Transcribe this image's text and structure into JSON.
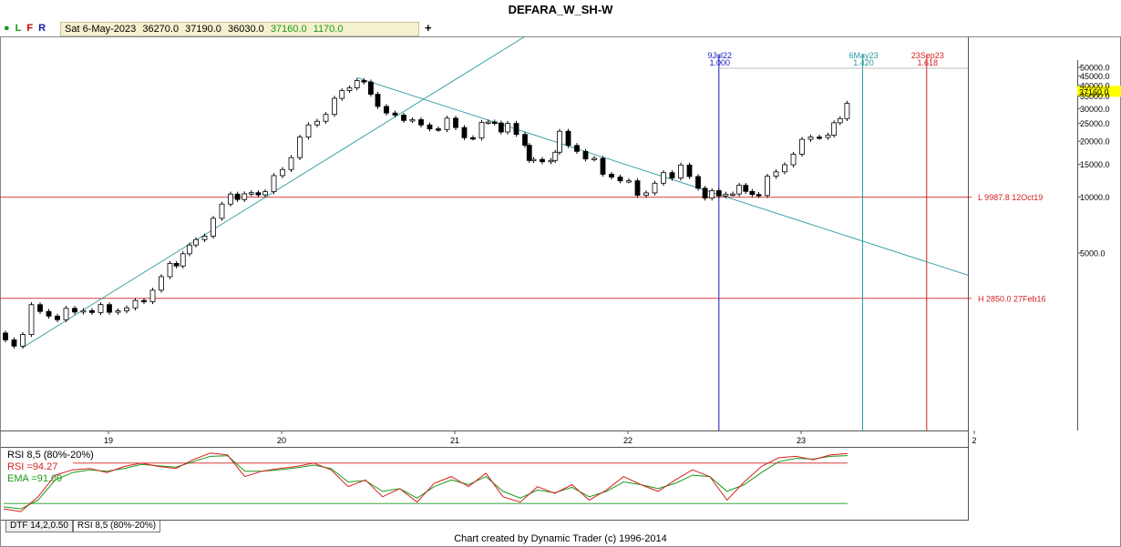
{
  "window": {
    "title": "DEFARA_W_SH-W"
  },
  "toolbar": {
    "icons": [
      {
        "glyph": "●",
        "color": "#1a9a1a",
        "name": "dot-icon"
      },
      {
        "glyph": "L",
        "color": "#1a9a1a",
        "name": "L"
      },
      {
        "glyph": "F",
        "color": "#c00000",
        "name": "F"
      },
      {
        "glyph": "R",
        "color": "#1a1aa0",
        "name": "R"
      }
    ],
    "info": {
      "date": "Sat 6-May-2023",
      "open": "36270.0",
      "high": "37190.0",
      "low": "36030.0",
      "close": "37160.0",
      "change": "1170.0"
    },
    "plus": "+"
  },
  "chart_data": {
    "type": "candlestick",
    "title": "DEFARA_W_SH-W",
    "yscale": "log",
    "y_ticks": [
      "50000.0",
      "45000.0",
      "40000.0",
      "35000.0",
      "30000.0",
      "25000.0",
      "20000.0",
      "15000.0",
      "10000.0",
      "5000.0"
    ],
    "y_tick_values": [
      50000,
      45000,
      40000,
      35000,
      30000,
      25000,
      20000,
      15000,
      10000,
      5000
    ],
    "x_tick_labels": [
      "19",
      "20",
      "21",
      "22",
      "23",
      "2"
    ],
    "last_price_label": "37160.0",
    "horizontal_levels": [
      {
        "label": "L 9987.8 12Oct19",
        "value": 9987.8,
        "color": "#d42020"
      },
      {
        "label": "H 2850.0 27Feb16",
        "value": 2850.0,
        "color": "#d42020"
      }
    ],
    "time_markers": [
      {
        "date": "9Jul22",
        "ratio": "1.000",
        "color": "#1a1ac8"
      },
      {
        "date": "6May23",
        "ratio": "1.420",
        "color": "#2a9aa0"
      },
      {
        "date": "23Sep23",
        "ratio": "1.618",
        "color": "#d42020"
      }
    ],
    "price_series": [
      {
        "t": 2018.35,
        "p": 1800
      },
      {
        "t": 2018.45,
        "p": 1550
      },
      {
        "t": 2018.55,
        "p": 2500
      },
      {
        "t": 2018.65,
        "p": 2300
      },
      {
        "t": 2018.75,
        "p": 2350
      },
      {
        "t": 2018.85,
        "p": 2500
      },
      {
        "t": 2018.95,
        "p": 2450
      },
      {
        "t": 2019.05,
        "p": 2500
      },
      {
        "t": 2019.15,
        "p": 2600
      },
      {
        "t": 2019.25,
        "p": 3200
      },
      {
        "t": 2019.35,
        "p": 4200
      },
      {
        "t": 2019.5,
        "p": 5800
      },
      {
        "t": 2019.6,
        "p": 7500
      },
      {
        "t": 2019.7,
        "p": 10500
      },
      {
        "t": 2019.78,
        "p": 9987.8
      },
      {
        "t": 2019.9,
        "p": 11000
      },
      {
        "t": 2020.0,
        "p": 14000
      },
      {
        "t": 2020.1,
        "p": 21000
      },
      {
        "t": 2020.2,
        "p": 26000
      },
      {
        "t": 2020.3,
        "p": 33000
      },
      {
        "t": 2020.43,
        "p": 44000
      },
      {
        "t": 2020.55,
        "p": 32000
      },
      {
        "t": 2020.65,
        "p": 26000
      },
      {
        "t": 2020.75,
        "p": 27000
      },
      {
        "t": 2020.85,
        "p": 22000
      },
      {
        "t": 2020.95,
        "p": 27000
      },
      {
        "t": 2021.05,
        "p": 20000
      },
      {
        "t": 2021.15,
        "p": 25000
      },
      {
        "t": 2021.3,
        "p": 24000
      },
      {
        "t": 2021.4,
        "p": 19000
      },
      {
        "t": 2021.45,
        "p": 15000
      },
      {
        "t": 2021.55,
        "p": 16000
      },
      {
        "t": 2021.6,
        "p": 21000
      },
      {
        "t": 2021.7,
        "p": 18000
      },
      {
        "t": 2021.8,
        "p": 15000
      },
      {
        "t": 2021.9,
        "p": 13000
      },
      {
        "t": 2022.0,
        "p": 11500
      },
      {
        "t": 2022.1,
        "p": 10500
      },
      {
        "t": 2022.2,
        "p": 13000
      },
      {
        "t": 2022.3,
        "p": 14500
      },
      {
        "t": 2022.4,
        "p": 11000
      },
      {
        "t": 2022.52,
        "p": 10000
      },
      {
        "t": 2022.6,
        "p": 11000
      },
      {
        "t": 2022.75,
        "p": 10500
      },
      {
        "t": 2022.85,
        "p": 14000
      },
      {
        "t": 2022.95,
        "p": 17000
      },
      {
        "t": 2023.05,
        "p": 22000
      },
      {
        "t": 2023.15,
        "p": 21000
      },
      {
        "t": 2023.22,
        "p": 28000
      },
      {
        "t": 2023.3,
        "p": 37160
      }
    ],
    "rsi_panel": {
      "label": "RSI 8,5 (80%-20%)",
      "rsi_label": "RSI =94.27",
      "ema_label": "EMA =91.09",
      "levels": [
        80,
        20
      ],
      "rsi_values": [
        12,
        8,
        30,
        62,
        70,
        72,
        66,
        75,
        80,
        75,
        72,
        85,
        95,
        92,
        60,
        68,
        72,
        75,
        80,
        70,
        45,
        55,
        30,
        42,
        22,
        50,
        60,
        45,
        65,
        30,
        22,
        45,
        35,
        48,
        25,
        40,
        60,
        48,
        38,
        55,
        70,
        60,
        25,
        52,
        75,
        88,
        90,
        85,
        92,
        94.27
      ],
      "ema_values": [
        15,
        12,
        25,
        55,
        66,
        70,
        68,
        72,
        78,
        76,
        74,
        82,
        90,
        91,
        68,
        68,
        70,
        73,
        77,
        72,
        52,
        54,
        38,
        42,
        28,
        45,
        55,
        48,
        60,
        38,
        28,
        40,
        36,
        44,
        30,
        38,
        52,
        48,
        42,
        50,
        62,
        60,
        38,
        48,
        66,
        82,
        87,
        86,
        90,
        91.09
      ]
    },
    "tabs": [
      "DTF 14,2,0.50",
      "RSI 8,5 (80%-20%)"
    ]
  },
  "footer": {
    "text": "Chart created by Dynamic Trader  (c) 1996-2014"
  }
}
